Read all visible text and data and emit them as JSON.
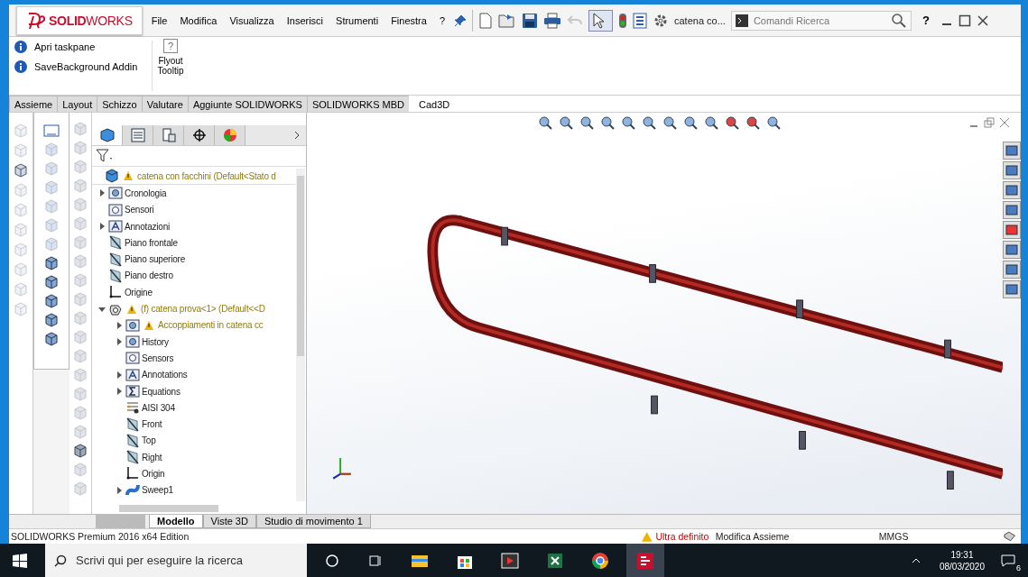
{
  "logo": {
    "text": "**SOLID**WORKS"
  },
  "menu": [
    "File",
    "Modifica",
    "Visualizza",
    "Inserisci",
    "Strumenti",
    "Finestra",
    "?"
  ],
  "document_title": "catena co...",
  "search": {
    "placeholder": "Comandi Ricerca"
  },
  "help": "?",
  "ribbon": {
    "items": [
      {
        "label": "Apri taskpane"
      },
      {
        "label": "SaveBackground Addin"
      }
    ],
    "flyout": {
      "glyph": "?",
      "label": "Flyout Tooltip"
    }
  },
  "tabs": [
    {
      "label": "Assieme",
      "selected": false
    },
    {
      "label": "Layout",
      "selected": false
    },
    {
      "label": "Schizzo",
      "selected": false
    },
    {
      "label": "Valutare",
      "selected": false
    },
    {
      "label": "Aggiunte SOLIDWORKS",
      "selected": false
    },
    {
      "label": "SOLIDWORKS MBD",
      "selected": false
    },
    {
      "label": "Cad3D",
      "selected": true
    }
  ],
  "panel_tabs": [
    {
      "kind": "tree",
      "selected": true
    },
    {
      "kind": "properties",
      "selected": false
    },
    {
      "kind": "config",
      "selected": false
    },
    {
      "kind": "target",
      "selected": false
    },
    {
      "kind": "display",
      "selected": false
    }
  ],
  "tree": {
    "label": "catena con facchini  (Default<Stato d",
    "kind": "assembly",
    "warning": true,
    "children": [
      {
        "label": "Cronologia",
        "kind": "history",
        "expanded": false
      },
      {
        "label": "Sensori",
        "kind": "sensor"
      },
      {
        "label": "Annotazioni",
        "kind": "annotation",
        "expanded": false
      },
      {
        "label": "Piano frontale",
        "kind": "plane"
      },
      {
        "label": "Piano superiore",
        "kind": "plane"
      },
      {
        "label": "Piano destro",
        "kind": "plane"
      },
      {
        "label": "Origine",
        "kind": "origin"
      },
      {
        "label": "(f) catena prova<1> (Default<<D",
        "kind": "part",
        "warning": true,
        "expanded": true,
        "children": [
          {
            "label": "Accoppiamenti in catena cc",
            "kind": "mates",
            "warning": true,
            "expanded": false
          },
          {
            "label": "History",
            "kind": "history",
            "expanded": false
          },
          {
            "label": "Sensors",
            "kind": "sensor"
          },
          {
            "label": "Annotations",
            "kind": "annotation",
            "expanded": false
          },
          {
            "label": "Equations",
            "kind": "equation",
            "expanded": false
          },
          {
            "label": "AISI 304",
            "kind": "material"
          },
          {
            "label": "Front",
            "kind": "plane"
          },
          {
            "label": "Top",
            "kind": "plane"
          },
          {
            "label": "Right",
            "kind": "plane"
          },
          {
            "label": "Origin",
            "kind": "origin"
          },
          {
            "label": "Sweep1",
            "kind": "sweep",
            "expanded": false
          }
        ]
      }
    ]
  },
  "bottom_tabs": [
    {
      "label": "Modello",
      "selected": true
    },
    {
      "label": "Viste 3D",
      "selected": false
    },
    {
      "label": "Studio di movimento 1",
      "selected": false
    }
  ],
  "status_bar": {
    "edition": "SOLIDWORKS Premium 2016 x64 Edition",
    "state": "Ultra definito",
    "mode": "Modifica Assieme",
    "units": "MMGS"
  },
  "taskbar": {
    "search": {
      "placeholder": "Scrivi qui per eseguire la ricerca"
    },
    "apps": [
      {
        "kind": "explorer",
        "selected": false
      },
      {
        "kind": "store",
        "selected": false
      },
      {
        "kind": "media",
        "selected": false
      },
      {
        "kind": "excel",
        "selected": false
      },
      {
        "kind": "chrome",
        "selected": false
      },
      {
        "kind": "solidworks",
        "selected": true
      }
    ],
    "time": "19:31",
    "date": "08/03/2020",
    "notifications": "6"
  }
}
